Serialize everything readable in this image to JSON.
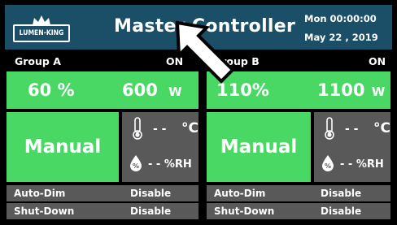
{
  "header": {
    "logo_text": "LUMEN-KING",
    "title": "Master Controller",
    "time": "Mon 00:00:00",
    "date": "May 22 , 2019",
    "background_color": "#1a4f67"
  },
  "groups": [
    {
      "name": "Group A",
      "state": "ON",
      "power_percent": "60 %",
      "power_watts": "600",
      "power_unit": "W",
      "mode": "Manual",
      "temp_value": "- -",
      "temp_unit": "°C",
      "humidity": "- - %RH",
      "auto_dim_label": "Auto-Dim",
      "auto_dim_value": "Disable",
      "shut_down_label": "Shut-Down",
      "shut_down_value": "Disable"
    },
    {
      "name": "Group B",
      "state": "ON",
      "power_percent": "110%",
      "power_watts": "1100",
      "power_unit": "W",
      "mode": "Manual",
      "temp_value": "- -",
      "temp_unit": "°C",
      "humidity": "- - %RH",
      "auto_dim_label": "Auto-Dim",
      "auto_dim_value": "Disable",
      "shut_down_label": "Shut-Down",
      "shut_down_value": "Disable"
    }
  ],
  "colors": {
    "accent_green": "#4ad865",
    "panel_gray": "#595959",
    "background": "#000000",
    "text": "#ffffff"
  },
  "icons": {
    "logo": "crown-icon",
    "temperature": "thermometer-icon",
    "humidity": "water-drop-icon",
    "pointer": "arrow-pointer-icon"
  }
}
